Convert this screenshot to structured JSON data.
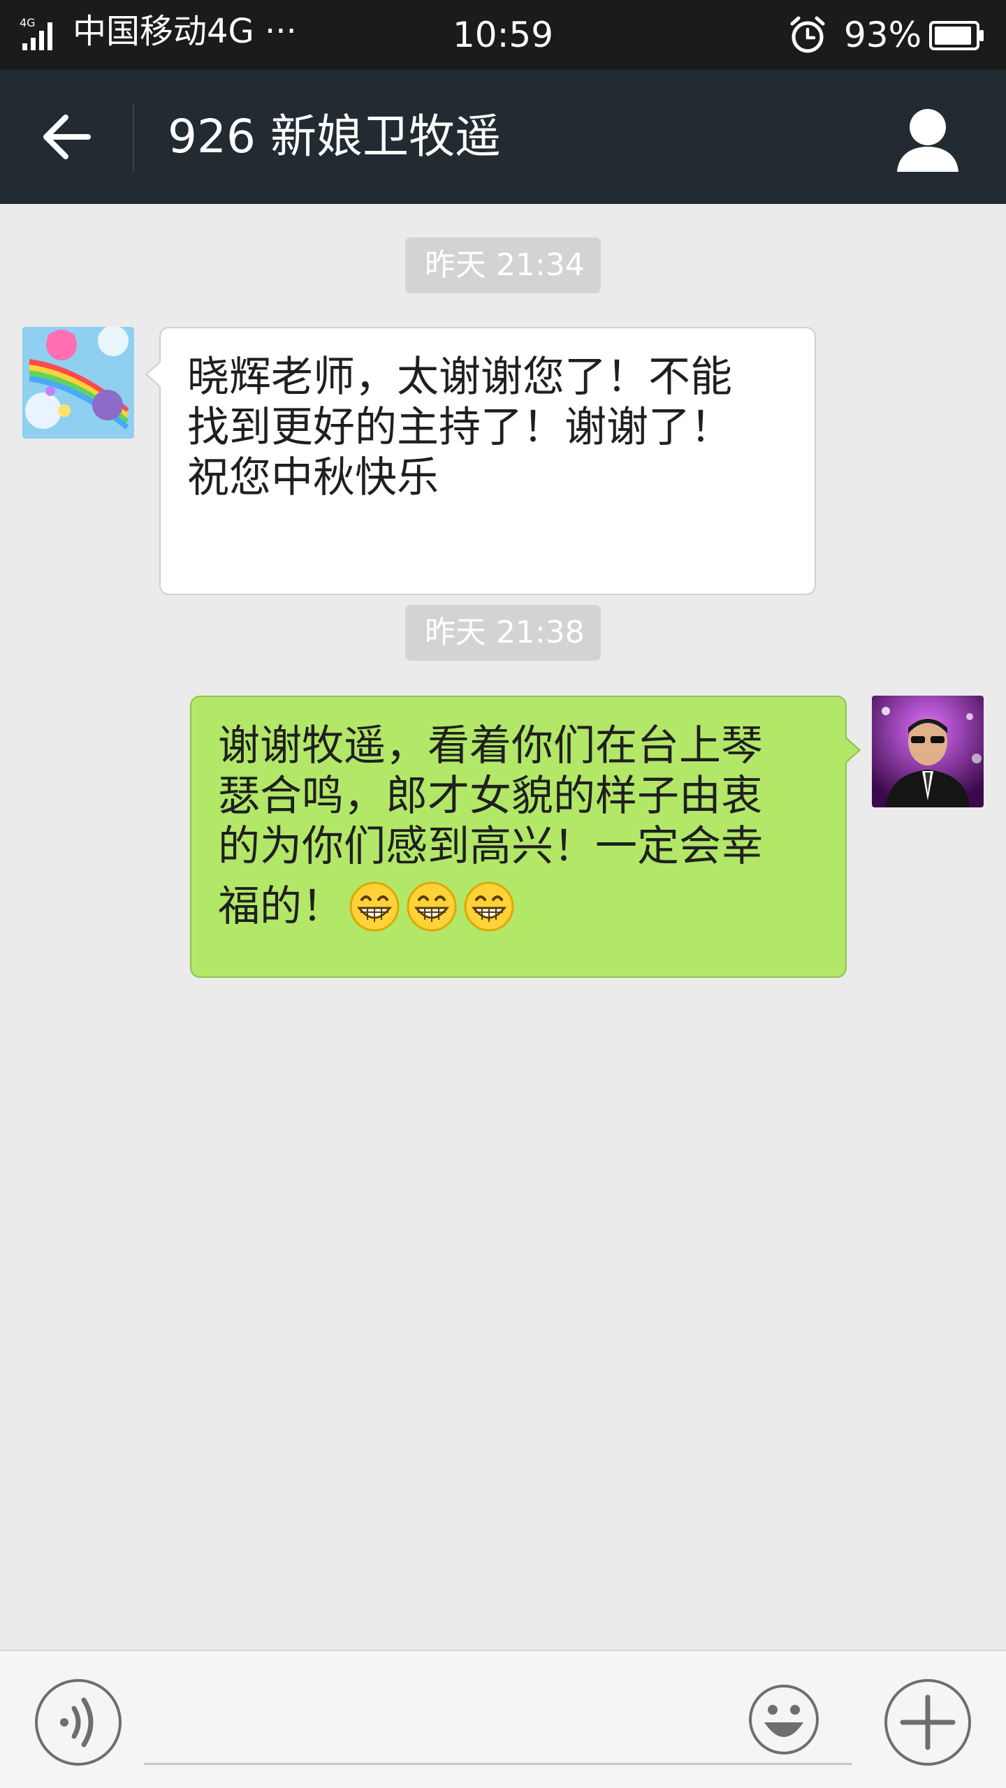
{
  "status_bar": {
    "network_badge": "4G",
    "carrier": "中国移动4G ···",
    "time": "10:59",
    "battery_percent": "93%",
    "battery_level": 0.93
  },
  "header": {
    "title": "926 新娘卫牧遥"
  },
  "messages": [
    {
      "timestamp": "昨天 21:34",
      "side": "left",
      "lines": [
        "晓辉老师，太谢谢您了！不能",
        "找到更好的主持了！谢谢了！",
        "祝您中秋快乐"
      ]
    },
    {
      "timestamp": "昨天 21:38",
      "side": "right",
      "lines": [
        "谢谢牧遥，看着你们在台上琴",
        "瑟合鸣，郎才女貌的样子由衷",
        "的为你们感到高兴！一定会幸",
        "福的！"
      ],
      "emojis": [
        "grin-emoji",
        "grin-emoji",
        "grin-emoji"
      ]
    }
  ],
  "icons": {
    "back": "arrow-left-icon",
    "profile": "person-icon",
    "voice": "voice-icon",
    "emoji": "smiley-icon",
    "more": "plus-icon",
    "alarm": "alarm-icon",
    "signal": "signal-icon",
    "battery": "battery-icon"
  },
  "colors": {
    "status_bar_bg": "#1b1b1d",
    "header_bg": "#222b31",
    "chat_bg": "#ebebeb",
    "outgoing_bubble": "#b2e768",
    "incoming_bubble": "#ffffff",
    "timestamp_bg": "#d3d3d3"
  }
}
